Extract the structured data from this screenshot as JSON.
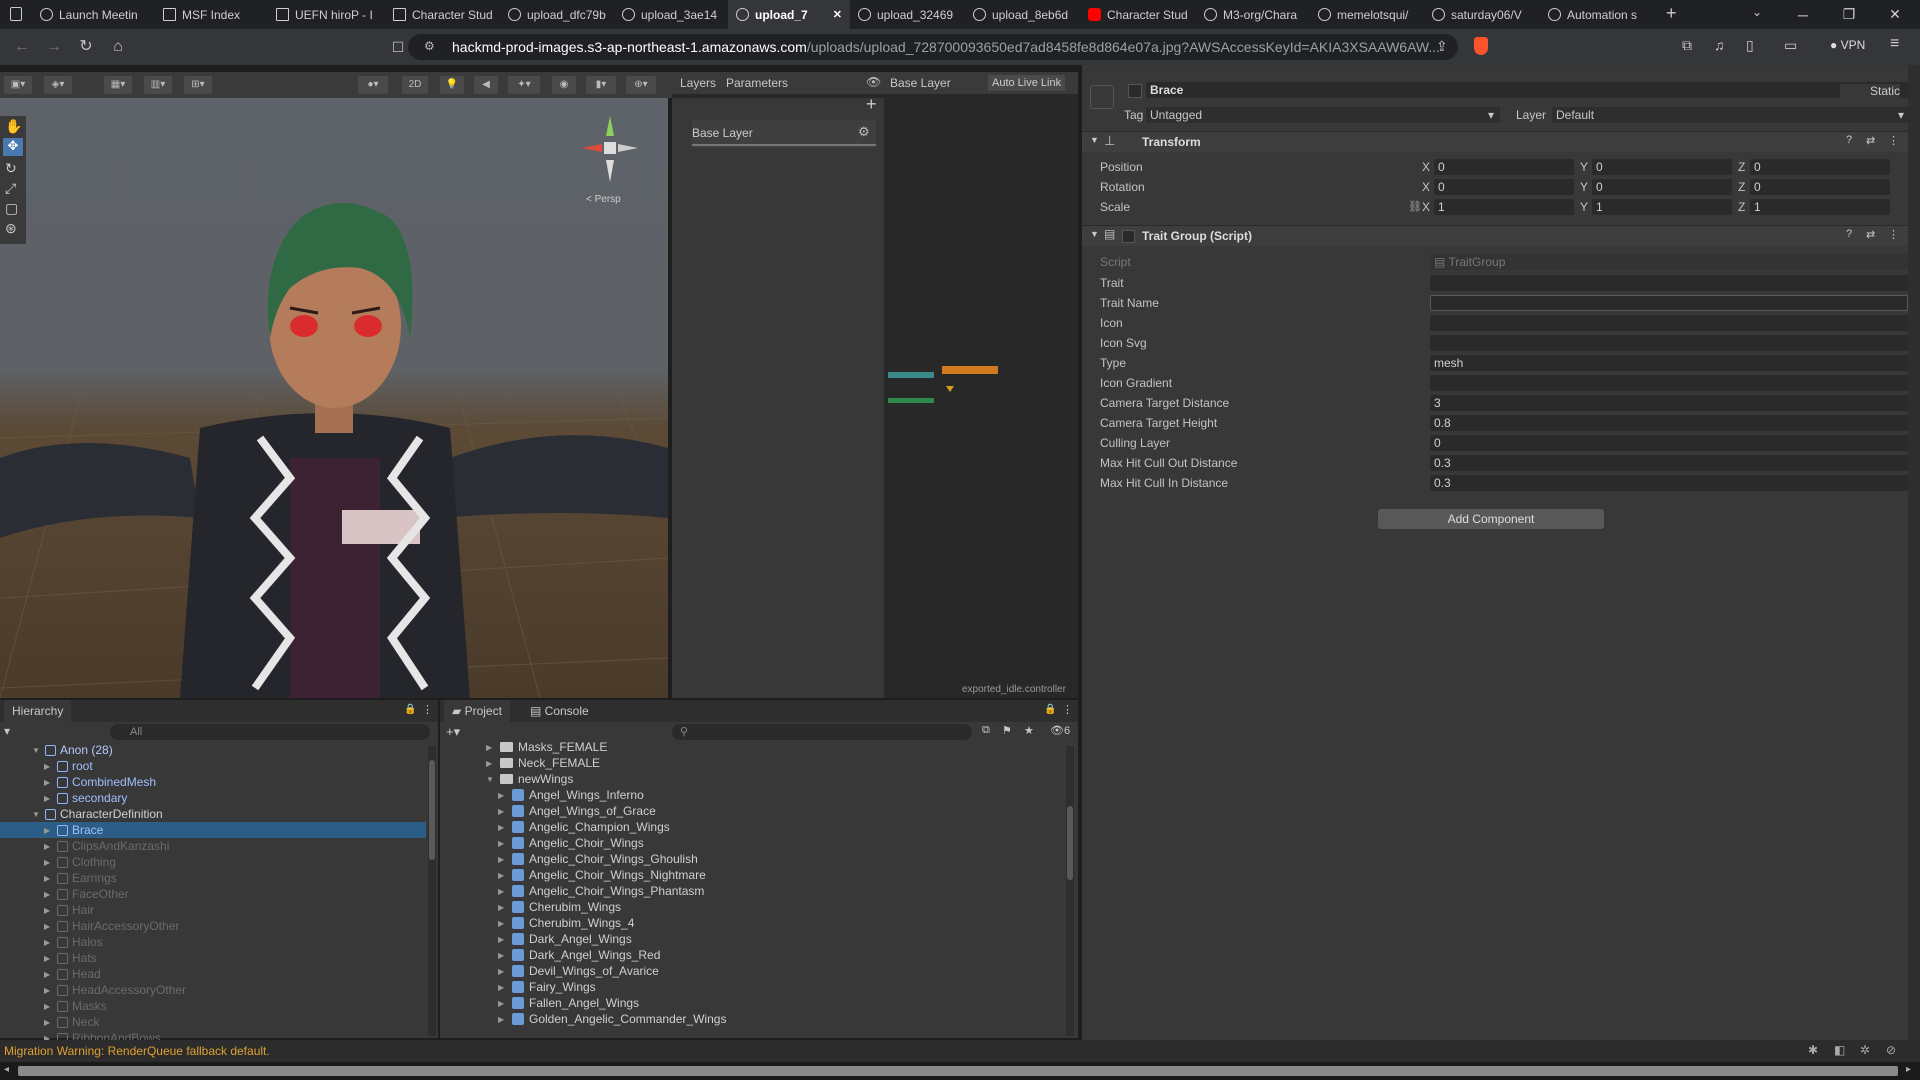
{
  "browser": {
    "tabs": [
      {
        "label": "Launch Meetin",
        "icon": "globe-icon"
      },
      {
        "label": "MSF Index",
        "icon": "doc-icon"
      },
      {
        "label": "UEFN hiroP - I",
        "icon": "doc-icon"
      },
      {
        "label": "Character Stud",
        "icon": "doc-icon"
      },
      {
        "label": "upload_dfc79b",
        "icon": "globe-icon"
      },
      {
        "label": "upload_3ae14",
        "icon": "globe-icon"
      },
      {
        "label": "upload_7",
        "icon": "globe-icon",
        "active": true
      },
      {
        "label": "upload_32469",
        "icon": "globe-icon"
      },
      {
        "label": "upload_8eb6d",
        "icon": "globe-icon"
      },
      {
        "label": "Character Stud",
        "icon": "youtube-icon"
      },
      {
        "label": "M3-org/Chara",
        "icon": "github-icon"
      },
      {
        "label": "memelotsqui/",
        "icon": "github-icon"
      },
      {
        "label": "saturday06/V",
        "icon": "github-icon"
      },
      {
        "label": "Automation s",
        "icon": "gear-icon"
      }
    ],
    "url_host": "hackmd-prod-images.s3-ap-northeast-1.amazonaws.com",
    "url_path": "/uploads/upload_728700093650ed7ad8458fe8d864e07a.jpg?AWSAccessKeyId=AKIA3XSAAW6AW...",
    "vpn_label": "VPN"
  },
  "animator": {
    "tabs": [
      "Layers",
      "Parameters"
    ],
    "breadcrumb": "Base Layer",
    "auto_live_link": "Auto Live Link",
    "layer_name": "Base Layer",
    "controller_file": "exported_idle.controller"
  },
  "scene": {
    "toolbar_2d": "2D",
    "persp_label": "< Persp"
  },
  "inspector": {
    "object_name": "Brace",
    "static_label": "Static",
    "tag_label": "Tag",
    "tag_value": "Untagged",
    "layer_label": "Layer",
    "layer_value": "Default",
    "transform": {
      "title": "Transform",
      "rows": [
        {
          "label": "Position",
          "x": "0",
          "y": "0",
          "z": "0"
        },
        {
          "label": "Rotation",
          "x": "0",
          "y": "0",
          "z": "0"
        },
        {
          "label": "Scale",
          "x": "1",
          "y": "1",
          "z": "1"
        }
      ]
    },
    "script": {
      "title": "Trait Group (Script)",
      "script_label": "Script",
      "script_value": "TraitGroup",
      "fields": [
        {
          "label": "Trait",
          "value": ""
        },
        {
          "label": "Trait Name",
          "value": ""
        },
        {
          "label": "Icon",
          "value": ""
        },
        {
          "label": "Icon Svg",
          "value": ""
        },
        {
          "label": "Type",
          "value": "mesh"
        },
        {
          "label": "Icon Gradient",
          "value": ""
        },
        {
          "label": "Camera Target Distance",
          "value": "3"
        },
        {
          "label": "Camera Target Height",
          "value": "0.8"
        },
        {
          "label": "Culling Layer",
          "value": "0"
        },
        {
          "label": "Max Hit Cull Out Distance",
          "value": "0.3"
        },
        {
          "label": "Max Hit Cull In Distance",
          "value": "0.3"
        }
      ]
    },
    "add_component": "Add Component"
  },
  "hierarchy": {
    "title": "Hierarchy",
    "search_placeholder": "All",
    "items": [
      {
        "label": "Anon (28)",
        "depth": 0,
        "expanded": true
      },
      {
        "label": "root",
        "depth": 1
      },
      {
        "label": "CombinedMesh",
        "depth": 1
      },
      {
        "label": "secondary",
        "depth": 1
      },
      {
        "label": "CharacterDefinition",
        "depth": 0,
        "expanded": true
      },
      {
        "label": "Brace",
        "depth": 1,
        "selected": true
      },
      {
        "label": "ClipsAndKanzashi",
        "depth": 1,
        "dim": true
      },
      {
        "label": "Clothing",
        "depth": 1,
        "dim": true
      },
      {
        "label": "Earrings",
        "depth": 1,
        "dim": true
      },
      {
        "label": "FaceOther",
        "depth": 1,
        "dim": true
      },
      {
        "label": "Hair",
        "depth": 1,
        "dim": true
      },
      {
        "label": "HairAccessoryOther",
        "depth": 1,
        "dim": true
      },
      {
        "label": "Halos",
        "depth": 1,
        "dim": true
      },
      {
        "label": "Hats",
        "depth": 1,
        "dim": true
      },
      {
        "label": "Head",
        "depth": 1,
        "dim": true
      },
      {
        "label": "HeadAccessoryOther",
        "depth": 1,
        "dim": true
      },
      {
        "label": "Masks",
        "depth": 1,
        "dim": true
      },
      {
        "label": "Neck",
        "depth": 1,
        "dim": true
      },
      {
        "label": "RibbonAndBows",
        "depth": 1,
        "dim": true
      }
    ]
  },
  "project": {
    "tabs": [
      "Project",
      "Console"
    ],
    "hidden_count": "6",
    "folders": [
      "Masks_FEMALE",
      "Neck_FEMALE",
      "newWings"
    ],
    "items": [
      "Angel_Wings_Inferno",
      "Angel_Wings_of_Grace",
      "Angelic_Champion_Wings",
      "Angelic_Choir_Wings",
      "Angelic_Choir_Wings_Ghoulish",
      "Angelic_Choir_Wings_Nightmare",
      "Angelic_Choir_Wings_Phantasm",
      "Cherubim_Wings",
      "Cherubim_Wings_4",
      "Dark_Angel_Wings",
      "Dark_Angel_Wings_Red",
      "Devil_Wings_of_Avarice",
      "Fairy_Wings",
      "Fallen_Angel_Wings",
      "Golden_Angelic_Commander_Wings"
    ]
  },
  "status": {
    "warning": "Migration Warning: RenderQueue fallback default."
  }
}
